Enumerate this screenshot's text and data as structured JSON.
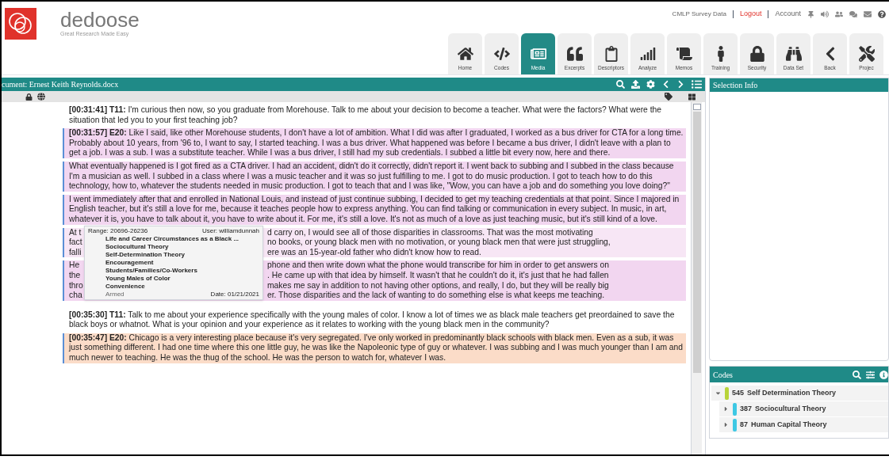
{
  "header": {
    "brand": "dedoose",
    "tagline": "Great Research Made Easy",
    "account_bar": {
      "project": "CMLP Survey Data",
      "logout": "Logout",
      "account": "Account"
    },
    "nav_tabs": [
      {
        "label": "Home",
        "selected": false
      },
      {
        "label": "Codes",
        "selected": false
      },
      {
        "label": "Media",
        "selected": true
      },
      {
        "label": "Excerpts",
        "selected": false
      },
      {
        "label": "Descriptors",
        "selected": false
      },
      {
        "label": "Analyze",
        "selected": false
      },
      {
        "label": "Memos",
        "selected": false
      },
      {
        "label": "Training",
        "selected": false
      },
      {
        "label": "Security",
        "selected": false
      },
      {
        "label": "Data Set",
        "selected": false
      },
      {
        "label": "Back",
        "selected": false
      },
      {
        "label": "Projec",
        "selected": false
      }
    ]
  },
  "document": {
    "title": "cument: Ernest Keith Reynolds.docx",
    "paragraphs": [
      {
        "kind": "turn",
        "timestamp": "[00:31:41]",
        "speaker": "T11:",
        "text": "I'm curious then now, so you graduate from Morehouse. Talk to me about your decision to become a teacher. What were the factors? What were the situation that led you to your first teaching job?"
      },
      {
        "kind": "turn",
        "timestamp": "[00:31:57]",
        "speaker": "E20:",
        "color": "#f2d6f0",
        "text": "Like I said, like other Morehouse students, I don't have a lot of ambition. What I did was after I graduated, I worked as a bus driver for CTA for a long time. Probably about 10 years, from '96 to, I want to say, I started teaching. I was a bus driver. What happened was before I became a bus driver, I didn't leave with a plan to get a job. I was a sub. I was a substitute teacher. While I was a bus driver, I still had my sub credentials. I subbed a little bit every now, here and there."
      },
      {
        "kind": "text",
        "color": "#f2d6f0",
        "text": "What eventually happened is I got fired as a CTA driver. I had an accident, didn't do it correctly, didn't report it. I went back to subbing and I subbed in the class because I'm a musician as well. I subbed in a class where I was a music teacher and it was so just fulfilling to me. I got to do music production. I got to teach how to do this technology, how to, whatever the students needed in music production. I got to teach that and I was like, \"Wow, you can have a job and do something you love doing?\""
      },
      {
        "kind": "text",
        "color": "#f2d6f0",
        "text": "I went immediately after that and enrolled in National Louis, and instead of just continue subbing, I decided to get my teaching credentials at that point. Since I majored in English teacher, but it's still a love for me, because it teaches people how to express anything. You can find talking or communication in every subject. In music, in art, whatever it is, you have to talk about it, you have to write about it. For me, it's still a love. It's not as much of a love as just teaching music, but it's still kind of a love."
      },
      {
        "kind": "obscured",
        "color": "#f7e6f5",
        "lines": [
          {
            "left": "At t",
            "right": "d carry on, I would see all of those disparities in classrooms. That was the most motivating"
          },
          {
            "left": "fact",
            "right": "no books, or young black men with no motivation, or young black men that were just struggling,"
          },
          {
            "left": "falli",
            "right": "ere was an 15-year-old father who didn't know how to read."
          }
        ]
      },
      {
        "kind": "obscured",
        "color": "#f2d6f0",
        "lines": [
          {
            "left": "He",
            "right": "phone and then write down what the phone would transcribe for him in order to get answers on"
          },
          {
            "left": "the",
            "right": ". He came up with that idea by himself. It wasn't that he couldn't do it, it's just that he had fallen"
          },
          {
            "left": "thro",
            "right": "makes me say in addition to not having other options, and really, I do, but they will be really big"
          },
          {
            "left": "cha",
            "right": "er. Those disparities and the lack of wanting to do something else is what keeps me teaching."
          }
        ]
      },
      {
        "kind": "turn",
        "timestamp": "[00:35:30]",
        "speaker": "T11:",
        "text": "Talk to me about your experience specifically with the young males of color. I know a lot of times we as black male teachers get preordained to save the black boys or whatnot. What is your opinion and your experience as it relates to working with the young black men in the community?"
      },
      {
        "kind": "turn",
        "timestamp": "[00:35:47]",
        "speaker": "E20:",
        "color": "#fbdcc8",
        "text": "Chicago is a very interesting place because it's very segregated. I've only worked in predominantly black schools with black men. Even as a sub, it was just something different. I had one time where this one little guy, he was like the Napoleonic type of guy or whatever. I was subbing and I was much younger than I am and much newer to teaching. He was the thug of the school. He was the person to watch for, whatever I was."
      }
    ],
    "excerpt_popup": {
      "range": "Range: 20696-26236",
      "user": "User: williamdunnah",
      "codes": [
        "Life and Career Circumstances as a Black ...",
        "Sociocultural Theory",
        "Self-Determination Theory",
        "Encouragement",
        "Students/Families/Co-Workers",
        "Young Males of Color",
        "Convenience"
      ],
      "footer_left": "Armed",
      "date": "Date: 01/21/2021"
    }
  },
  "selection_info": {
    "title": "Selection Info"
  },
  "codes_panel": {
    "title": "Codes",
    "items": [
      {
        "count": "545",
        "label": "Self Determination Theory",
        "color": "#b8d43a",
        "expanded": true,
        "children": [
          {
            "count": "387",
            "label": "Sociocultural Theory",
            "color": "#3ec8e4",
            "expanded": false
          },
          {
            "count": "87",
            "label": "Human Capital Theory",
            "color": "#3ec8e4",
            "expanded": false
          }
        ]
      }
    ]
  }
}
